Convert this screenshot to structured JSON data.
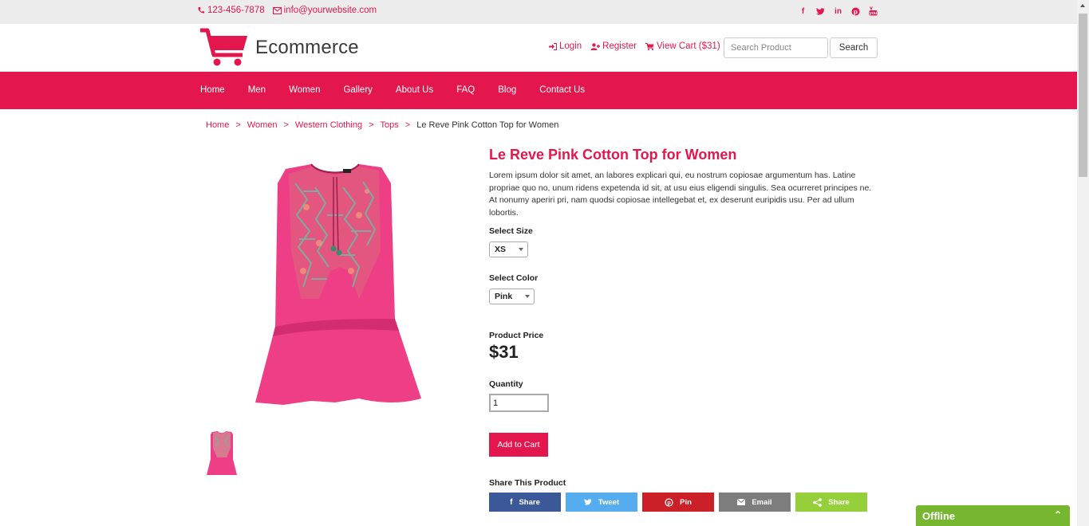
{
  "topbar": {
    "phone": "123-456-7878",
    "email": "info@yourwebsite.com",
    "social": [
      "facebook-icon",
      "twitter-icon",
      "linkedin-icon",
      "pinterest-icon",
      "youtube-icon"
    ]
  },
  "header": {
    "logo_text": "Ecommerce",
    "login": "Login",
    "register": "Register",
    "view_cart": "View Cart ($31)",
    "search_placeholder": "Search Product",
    "search_button": "Search"
  },
  "nav": {
    "items": [
      "Home",
      "Men",
      "Women",
      "Gallery",
      "About Us",
      "FAQ",
      "Blog",
      "Contact Us"
    ]
  },
  "breadcrumb": {
    "items": [
      "Home",
      "Women",
      "Western Clothing",
      "Tops"
    ],
    "current": "Le Reve Pink Cotton Top for Women"
  },
  "product": {
    "title": "Le Reve Pink Cotton Top for Women",
    "description": "Lorem ipsum dolor sit amet, an labores explicari qui, eu nostrum copiosae argumentum has. Latine propriae quo no, unum ridens expetenda id sit, at usu eius eligendi singulis. Sea ocurreret principes ne. At nonumy aperiri pri, nam quodsi copiosae intellegebat et, ex deserunt euripidis usu. Per ad ullum lobortis.",
    "size_label": "Select Size",
    "size_value": "XS",
    "color_label": "Select Color",
    "color_value": "Pink",
    "price_label": "Product Price",
    "price": "$31",
    "quantity_label": "Quantity",
    "quantity": "1",
    "add_to_cart": "Add to Cart",
    "share_label": "Share This Product"
  },
  "share_buttons": [
    {
      "label": "Share",
      "icon": "facebook-icon",
      "color": "#3b5998"
    },
    {
      "label": "Tweet",
      "icon": "twitter-icon",
      "color": "#55acee"
    },
    {
      "label": "Pin",
      "icon": "pinterest-icon",
      "color": "#cb2027"
    },
    {
      "label": "Email",
      "icon": "email-icon",
      "color": "#7d7d7d"
    },
    {
      "label": "Share",
      "icon": "share-icon",
      "color": "#95d03a"
    }
  ],
  "chat": {
    "status": "Offline"
  },
  "colors": {
    "accent": "#e3174e",
    "offline": "#77b62f"
  }
}
